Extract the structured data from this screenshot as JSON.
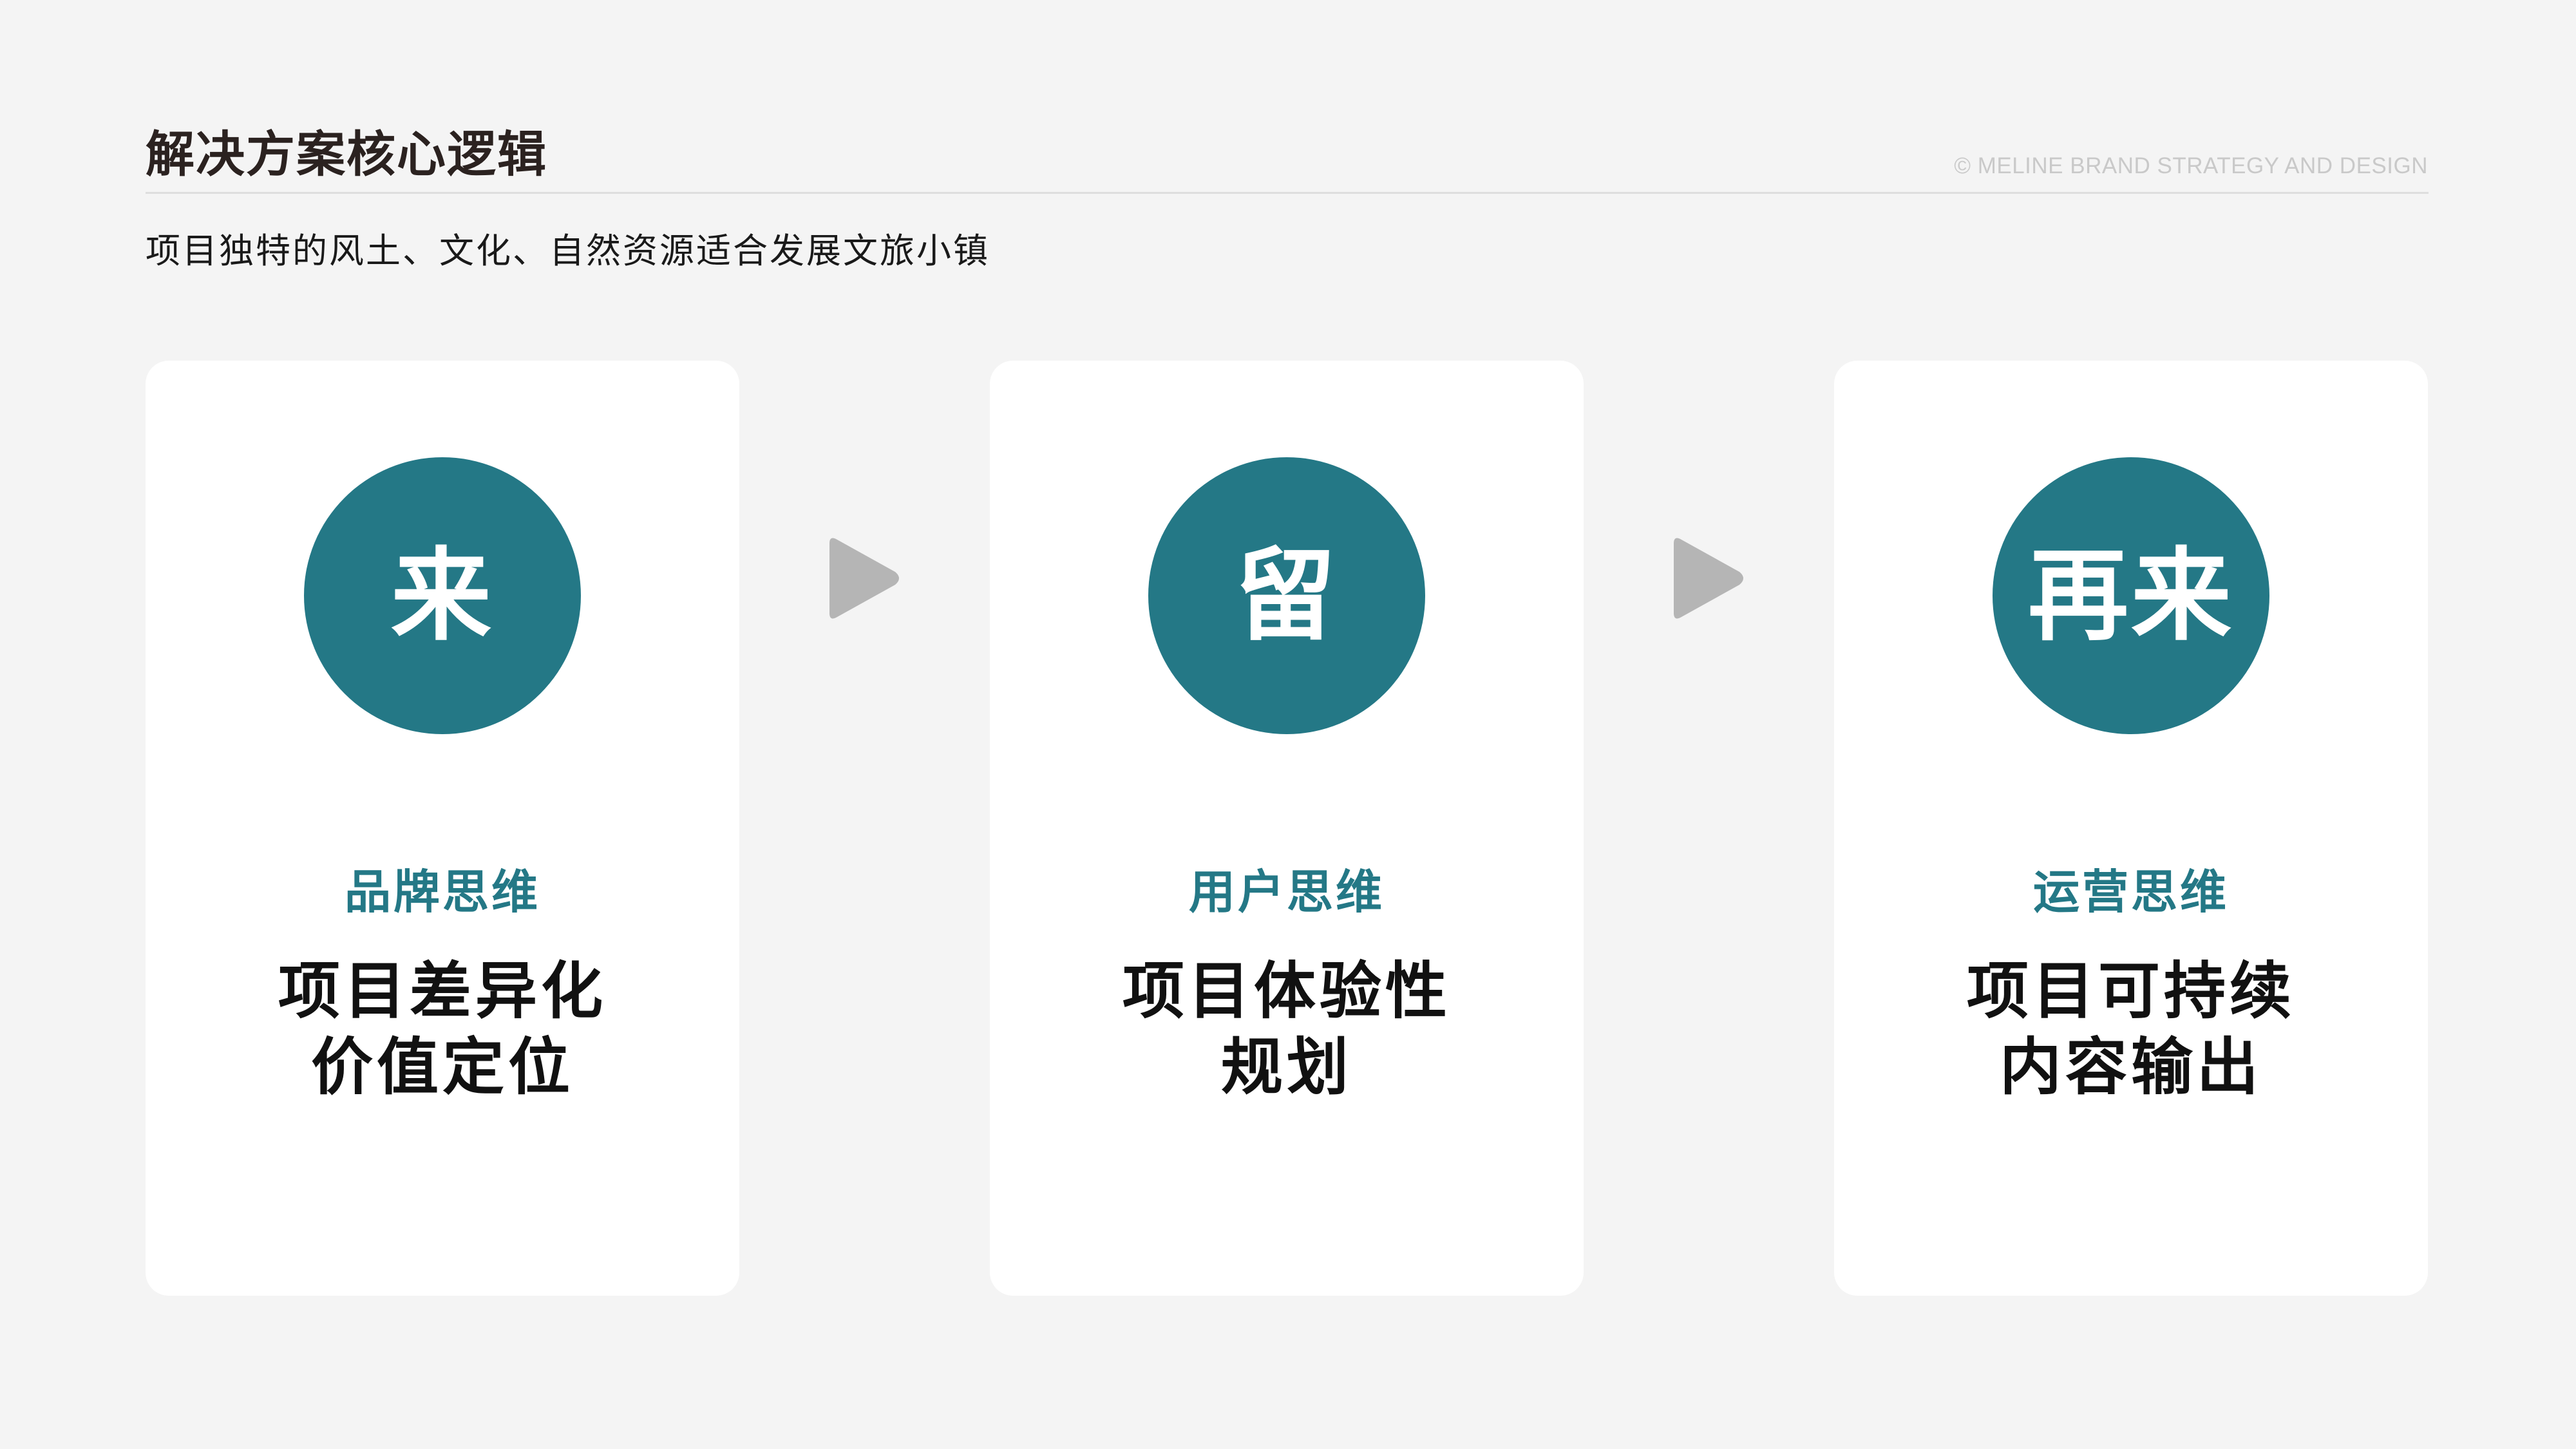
{
  "header": {
    "title": "解决方案核心逻辑",
    "copyright": "© MELINE BRAND STRATEGY AND DESIGN",
    "subtitle": "项目独特的风土、文化、自然资源适合发展文旅小镇"
  },
  "colors": {
    "accent": "#247886",
    "arrow": "#b5b5b5",
    "background": "#f4f4f4",
    "card": "#ffffff"
  },
  "cards": [
    {
      "circle": "来",
      "mode": "品牌思维",
      "lines": [
        "项目差异化",
        "价值定位"
      ]
    },
    {
      "circle": "留",
      "mode": "用户思维",
      "lines": [
        "项目体验性",
        "规划"
      ]
    },
    {
      "circle": "再来",
      "mode": "运营思维",
      "lines": [
        "项目可持续",
        "内容输出"
      ]
    }
  ],
  "arrows": [
    {
      "icon": "play-arrow-icon"
    },
    {
      "icon": "play-arrow-icon"
    }
  ]
}
